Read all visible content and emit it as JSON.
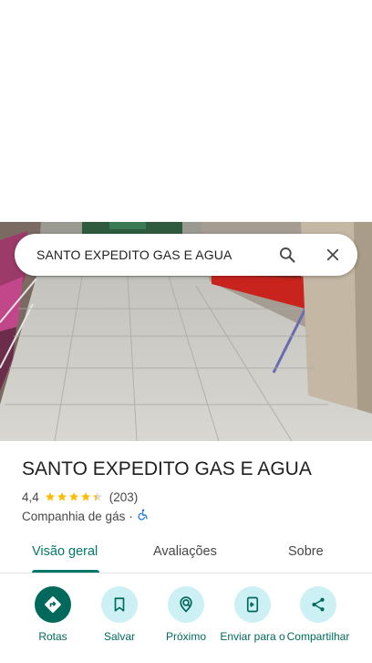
{
  "search": {
    "query": "SANTO EXPEDITO GAS E AGUA",
    "search_icon": "search-icon",
    "close_icon": "close-icon"
  },
  "place": {
    "name": "SANTO EXPEDITO GAS E AGUA",
    "rating": "4,4",
    "rating_value": 4.4,
    "star_color": "#fbbc04",
    "review_count": "(203)",
    "category": "Companhia de gás",
    "separator": "·",
    "accessibility_icon": "wheelchair-icon"
  },
  "tabs": [
    {
      "label": "Visão geral",
      "active": true
    },
    {
      "label": "Avaliações",
      "active": false
    },
    {
      "label": "Sobre",
      "active": false
    }
  ],
  "actions": [
    {
      "label": "Rotas",
      "icon": "directions-icon"
    },
    {
      "label": "Salvar",
      "icon": "bookmark-icon"
    },
    {
      "label": "Próximo",
      "icon": "nearby-icon"
    },
    {
      "label": "Enviar para o",
      "icon": "send-to-phone-icon"
    },
    {
      "label": "Compartilhar",
      "icon": "share-icon"
    }
  ],
  "colors": {
    "accent": "#00796b",
    "action_bg": "#cdf0f5",
    "primary_action_bg": "#00695c"
  }
}
